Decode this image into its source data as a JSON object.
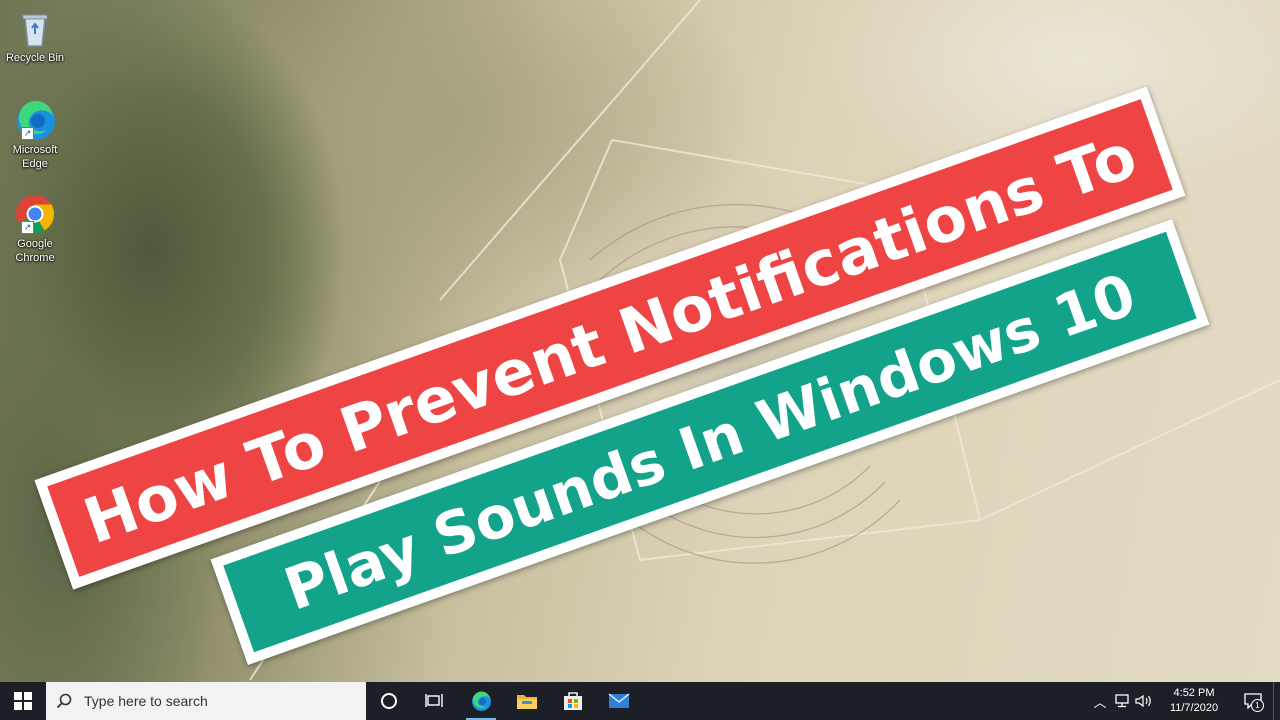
{
  "desktop": {
    "icons": [
      {
        "label": "Recycle Bin",
        "icon": "recycle-bin-icon"
      },
      {
        "label": "Microsoft Edge",
        "icon": "edge-icon"
      },
      {
        "label": "Google Chrome",
        "icon": "chrome-icon"
      }
    ]
  },
  "banners": {
    "line1": "How To Prevent Notifications To",
    "line2": "Play Sounds In Windows 10",
    "line1_color": "#ef4444",
    "line2_color": "#12a38a"
  },
  "taskbar": {
    "search_placeholder": "Type here to search",
    "pinned": [
      "task-view-icon",
      "edge-icon",
      "file-explorer-icon",
      "store-icon",
      "mail-icon"
    ],
    "clock": {
      "time": "4:52 PM",
      "date": "11/7/2020"
    },
    "notification_count": "1"
  }
}
